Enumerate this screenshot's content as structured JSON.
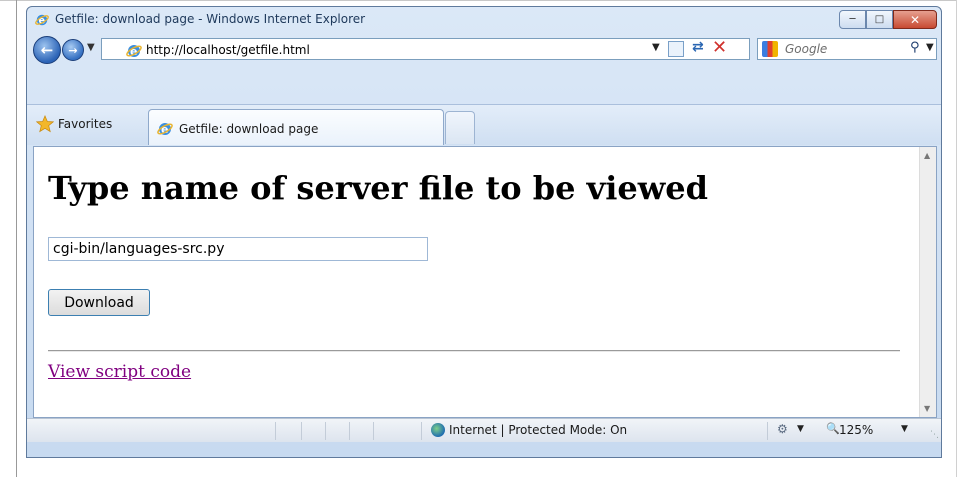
{
  "window": {
    "title": "Getfile: download page - Windows Internet Explorer"
  },
  "address_bar": {
    "url": "http://localhost/getfile.html"
  },
  "search": {
    "placeholder": "Google"
  },
  "tabs": {
    "favorites_label": "Favorites",
    "active_tab_label": "Getfile: download page"
  },
  "page": {
    "heading": "Type name of server file to be viewed",
    "file_input_value": "cgi-bin/languages-src.py",
    "download_label": "Download",
    "script_link": "View script code"
  },
  "status": {
    "zone": "Internet | Protected Mode: On",
    "zoom": "125%"
  }
}
